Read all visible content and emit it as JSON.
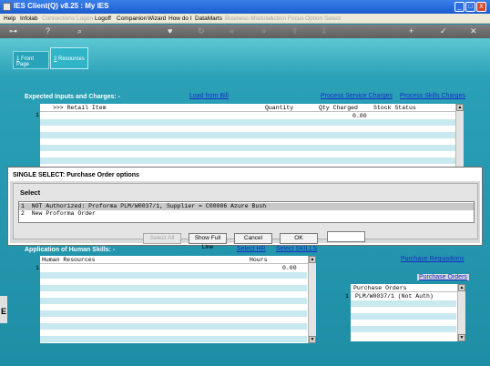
{
  "window": {
    "title": "IES Client(Q) v8.25 : My IES",
    "buttons": [
      "_",
      "□",
      "X"
    ]
  },
  "menu": [
    {
      "label": "Help",
      "enabled": true
    },
    {
      "label": "Infolab",
      "enabled": true
    },
    {
      "label": "Connections",
      "enabled": false
    },
    {
      "label": "Logon",
      "enabled": false
    },
    {
      "label": "Logoff",
      "enabled": true
    },
    {
      "label": "Companion",
      "enabled": true
    },
    {
      "label": "Wizard",
      "enabled": true
    },
    {
      "label": "How do I",
      "enabled": true
    },
    {
      "label": "DataMarts",
      "enabled": true
    },
    {
      "label": "Business Modules",
      "enabled": false
    },
    {
      "label": "Action Focus",
      "enabled": false
    },
    {
      "label": "Option Select",
      "enabled": false
    }
  ],
  "toolbar": {
    "icons": [
      "key-icon",
      "help-icon",
      "search-icon",
      "heart-icon",
      "refresh-icon",
      "rewind-icon",
      "forward-icon",
      "upload-icon",
      "download-icon",
      "plus-icon",
      "check-icon",
      "close-icon"
    ]
  },
  "tabs": [
    {
      "num": "1",
      "label": " Front Page"
    },
    {
      "num": "2",
      "label": " Resources"
    }
  ],
  "inputs_section": {
    "label": "Expected Inputs and Charges: -",
    "links": {
      "load": "Load from Bill",
      "process_service": "Process Service Charges",
      "process_skills": "Process Skills Charges"
    },
    "columns": {
      "item": ">>> Retail Item",
      "quantity": "Quantity",
      "qty_charged": "Qty Charged",
      "stock": "Stock Status"
    },
    "row_number": "1",
    "qty_charged_value": "0.00"
  },
  "dialog": {
    "title": "SINGLE SELECT: Purchase Order options",
    "select_label": "Select",
    "options": [
      {
        "num": "1",
        "text": "NOT Authorized: Proforma PLM/W0037/1, Supplier = C00006 Azure Bush"
      },
      {
        "num": "2",
        "text": "New Proforma Order"
      }
    ],
    "buttons": {
      "disabled": "Select All",
      "show_full": "Show Full Line",
      "cancel": "Cancel",
      "ok": "OK"
    }
  },
  "skills_section": {
    "label": "Application of Human Skills: -",
    "links": {
      "select_hr": "Select HR",
      "select_skills": "Select SKILLS"
    },
    "columns": {
      "hr": "Human Resources",
      "hours": "Hours"
    },
    "row_number": "1",
    "hours_value": "0.00"
  },
  "purchase": {
    "requisitions": "Purchase Requisitions",
    "orders": "Purchase Orders",
    "column": "Purchase Orders",
    "row_number": "1",
    "row_value": "PLM/W0037/1 (Not Auth)"
  },
  "footer_fragment": "E"
}
